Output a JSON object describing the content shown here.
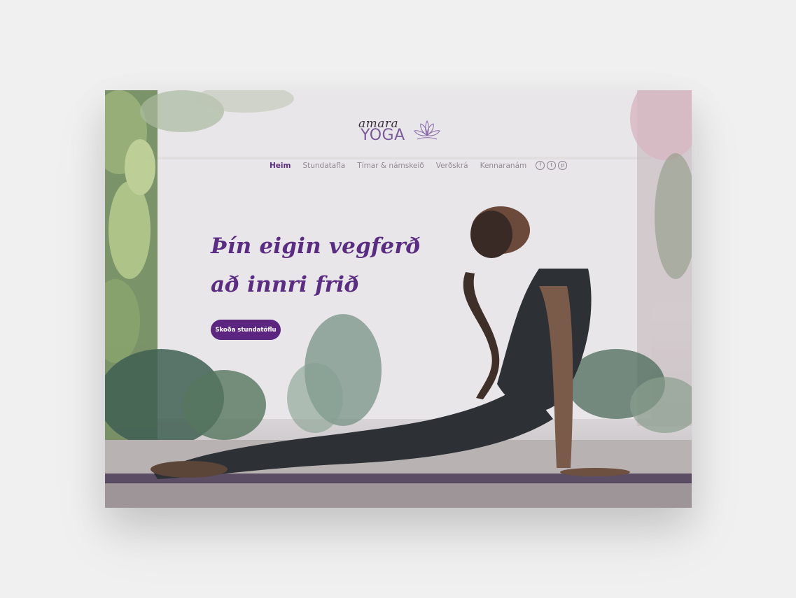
{
  "logo": {
    "script": "amara",
    "word": "YOGA",
    "lotus_icon": "lotus-icon"
  },
  "nav": {
    "items": [
      {
        "label": "Heim",
        "active": true
      },
      {
        "label": "Stundatafla",
        "active": false
      },
      {
        "label": "Tímar & námskeið",
        "active": false
      },
      {
        "label": "Verðskrá",
        "active": false
      },
      {
        "label": "Kennaranám",
        "active": false
      }
    ],
    "social": [
      {
        "icon": "facebook-icon",
        "glyph": "f"
      },
      {
        "icon": "twitter-icon",
        "glyph": "t"
      },
      {
        "icon": "pinterest-icon",
        "glyph": "p"
      }
    ]
  },
  "hero": {
    "headline_line1": "Þín eigin vegferð",
    "headline_line2": "að innri frið",
    "cta_label": "Skoða stundatöflu"
  },
  "colors": {
    "brand_purple": "#5b2580",
    "nav_text": "#8f8a93",
    "background": "#f0f0f1"
  }
}
